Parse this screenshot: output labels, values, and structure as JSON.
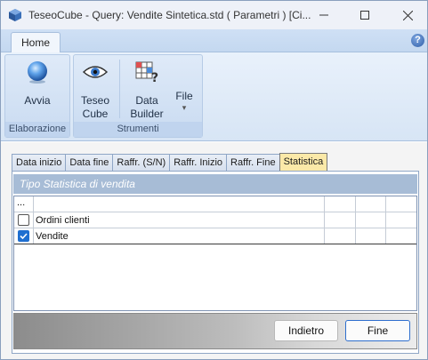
{
  "window": {
    "title": "TeseoCube - Query: Vendite Sintetica.std ( Parametri ) [Ci...",
    "icon": "teseocube-app-icon"
  },
  "ribbon": {
    "tabs": [
      {
        "label": "Home",
        "active": true
      }
    ],
    "help_icon": "?",
    "groups": [
      {
        "label": "Elaborazione",
        "buttons": [
          {
            "label": "Avvia",
            "icon": "blue-orb-icon"
          }
        ]
      },
      {
        "label": "Strumenti",
        "buttons": [
          {
            "label_line1": "Teseo",
            "label_line2": "Cube",
            "icon": "eye-icon"
          },
          {
            "label_line1": "Data",
            "label_line2": "Builder",
            "icon": "data-builder-icon"
          },
          {
            "label": "File",
            "arrow": "▾",
            "icon": "dropdown-arrow-icon"
          }
        ]
      }
    ]
  },
  "param_tabs": [
    {
      "label": "Data inizio",
      "active": false
    },
    {
      "label": "Data fine",
      "active": false
    },
    {
      "label": "Raffr. (S/N)",
      "active": false
    },
    {
      "label": "Raffr. Inizio",
      "active": false
    },
    {
      "label": "Raffr. Fine",
      "active": false
    },
    {
      "label": "Statistica",
      "active": true
    }
  ],
  "panel": {
    "header": "Tipo Statistica di vendita",
    "grid": {
      "header_text": "...",
      "rows": [
        {
          "label": "Ordini clienti",
          "checked": false
        },
        {
          "label": "Vendite",
          "checked": true
        }
      ]
    }
  },
  "footer": {
    "back_label": "Indietro",
    "finish_label": "Fine"
  },
  "colors": {
    "ribbon_bg": "#d7e5f5",
    "active_tab": "#fbe9a8",
    "panel_header": "#a7bcd6",
    "checkbox_checked": "#1f6fd0"
  }
}
